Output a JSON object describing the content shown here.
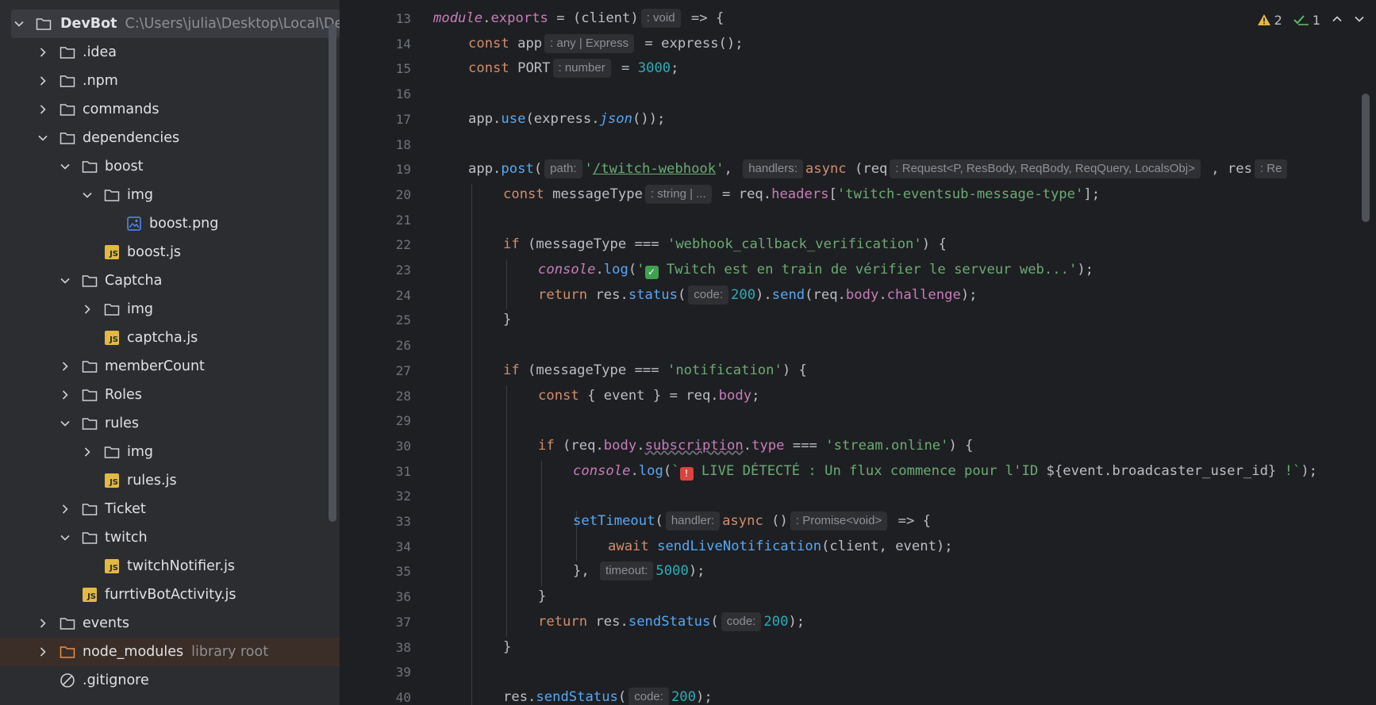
{
  "project_tree": {
    "root": {
      "name": "DevBot",
      "path": "C:\\Users\\julia\\Desktop\\Local\\Dev"
    },
    "items": [
      {
        "label": "idea",
        "name": ".idea",
        "type": "folder",
        "depth": 1,
        "expanded": false
      },
      {
        "label": "npm",
        "name": ".npm",
        "type": "folder",
        "depth": 1,
        "expanded": false
      },
      {
        "label": "commands",
        "name": "commands",
        "type": "folder",
        "depth": 1,
        "expanded": false
      },
      {
        "label": "dependencies",
        "name": "dependencies",
        "type": "folder",
        "depth": 1,
        "expanded": true
      },
      {
        "label": "boost",
        "name": "boost",
        "type": "folder",
        "depth": 2,
        "expanded": true
      },
      {
        "label": "img",
        "name": "img",
        "type": "folder",
        "depth": 3,
        "expanded": true
      },
      {
        "label": "boost-png",
        "name": "boost.png",
        "type": "image",
        "depth": 4
      },
      {
        "label": "boost-js",
        "name": "boost.js",
        "type": "js",
        "depth": 3
      },
      {
        "label": "captcha",
        "name": "Captcha",
        "type": "folder",
        "depth": 2,
        "expanded": true
      },
      {
        "label": "img",
        "name": "img",
        "type": "folder",
        "depth": 3,
        "expanded": false
      },
      {
        "label": "captcha-js",
        "name": "captcha.js",
        "type": "js",
        "depth": 3
      },
      {
        "label": "membercount",
        "name": "memberCount",
        "type": "folder",
        "depth": 2,
        "expanded": false
      },
      {
        "label": "roles",
        "name": "Roles",
        "type": "folder",
        "depth": 2,
        "expanded": false
      },
      {
        "label": "rules",
        "name": "rules",
        "type": "folder",
        "depth": 2,
        "expanded": true
      },
      {
        "label": "img",
        "name": "img",
        "type": "folder",
        "depth": 3,
        "expanded": false
      },
      {
        "label": "rules-js",
        "name": "rules.js",
        "type": "js",
        "depth": 3
      },
      {
        "label": "ticket",
        "name": "Ticket",
        "type": "folder",
        "depth": 2,
        "expanded": false
      },
      {
        "label": "twitch",
        "name": "twitch",
        "type": "folder",
        "depth": 2,
        "expanded": true
      },
      {
        "label": "twitchnotifier-js",
        "name": "twitchNotifier.js",
        "type": "js",
        "depth": 3
      },
      {
        "label": "furrtivbotactivity-js",
        "name": "furrtivBotActivity.js",
        "type": "js",
        "depth": 2
      },
      {
        "label": "events",
        "name": "events",
        "type": "folder",
        "depth": 1,
        "expanded": false
      },
      {
        "label": "node-modules",
        "name": "node_modules",
        "type": "folder-excluded",
        "depth": 1,
        "expanded": false,
        "note": "library root"
      },
      {
        "label": "gitignore",
        "name": ".gitignore",
        "type": "ignore",
        "depth": 1
      }
    ]
  },
  "inspections": {
    "warnings": "2",
    "ok": "1"
  },
  "editor": {
    "lines": [
      {
        "n": "13",
        "indent": 0,
        "tokens": [
          [
            "it prop",
            "module"
          ],
          [
            "",
            "."
          ],
          [
            "prop",
            "exports"
          ],
          [
            "",
            " = (client)"
          ],
          [
            "hint",
            ": void"
          ],
          [
            "",
            " => {"
          ]
        ]
      },
      {
        "n": "14",
        "indent": 1,
        "tokens": [
          [
            "kw",
            "const "
          ],
          [
            "",
            "app"
          ],
          [
            "hint",
            ": any | Express"
          ],
          [
            "",
            " = express();"
          ]
        ]
      },
      {
        "n": "15",
        "indent": 1,
        "tokens": [
          [
            "kw",
            "const "
          ],
          [
            "",
            "PORT"
          ],
          [
            "hint",
            ": number"
          ],
          [
            "",
            " = "
          ],
          [
            "num",
            "3000"
          ],
          [
            "",
            ";"
          ]
        ]
      },
      {
        "n": "16",
        "indent": 0,
        "tokens": []
      },
      {
        "n": "17",
        "indent": 1,
        "tokens": [
          [
            "",
            "app."
          ],
          [
            "fn",
            "use"
          ],
          [
            "",
            "(express."
          ],
          [
            "it fn",
            "json"
          ],
          [
            "",
            "());"
          ]
        ]
      },
      {
        "n": "18",
        "indent": 0,
        "tokens": []
      },
      {
        "n": "19",
        "indent": 1,
        "tokens": [
          [
            "",
            "app."
          ],
          [
            "fn",
            "post"
          ],
          [
            "",
            "("
          ],
          [
            "hint",
            "path:"
          ],
          [
            "str",
            "'"
          ],
          [
            "str und",
            "/twitch-webhook"
          ],
          [
            "str",
            "'"
          ],
          [
            "",
            ", "
          ],
          [
            "hint",
            "handlers:"
          ],
          [
            "kw",
            "async "
          ],
          [
            "",
            "(req"
          ],
          [
            "hint",
            ": Request<P, ResBody, ReqBody, ReqQuery, LocalsObj>"
          ],
          [
            "",
            " , res"
          ],
          [
            "hint",
            ": Re"
          ]
        ]
      },
      {
        "n": "20",
        "indent": 2,
        "tokens": [
          [
            "kw",
            "const "
          ],
          [
            "",
            "messageType"
          ],
          [
            "hint",
            ": string | ..."
          ],
          [
            "",
            " = req."
          ],
          [
            "prop",
            "headers"
          ],
          [
            "",
            "["
          ],
          [
            "str",
            "'twitch-eventsub-message-type'"
          ],
          [
            "",
            "];"
          ]
        ]
      },
      {
        "n": "21",
        "indent": 0,
        "tokens": []
      },
      {
        "n": "22",
        "indent": 2,
        "tokens": [
          [
            "kw",
            "if "
          ],
          [
            "",
            "(messageType === "
          ],
          [
            "str",
            "'webhook_callback_verification'"
          ],
          [
            "",
            ") {"
          ]
        ]
      },
      {
        "n": "23",
        "indent": 3,
        "tokens": [
          [
            "it prop",
            "console"
          ],
          [
            "",
            "."
          ],
          [
            "fn",
            "log"
          ],
          [
            "",
            "("
          ],
          [
            "str",
            "'"
          ],
          [
            "emoji-green",
            "✓"
          ],
          [
            "str",
            " Twitch est en train de vérifier le serveur web...'"
          ],
          [
            "",
            ");"
          ]
        ]
      },
      {
        "n": "24",
        "indent": 3,
        "tokens": [
          [
            "kw",
            "return "
          ],
          [
            "",
            "res."
          ],
          [
            "fn",
            "status"
          ],
          [
            "",
            "("
          ],
          [
            "hint",
            "code:"
          ],
          [
            "num",
            "200"
          ],
          [
            "",
            ")."
          ],
          [
            "fn",
            "send"
          ],
          [
            "",
            "(req."
          ],
          [
            "prop",
            "body"
          ],
          [
            "",
            "."
          ],
          [
            "prop",
            "challenge"
          ],
          [
            "",
            ");"
          ]
        ]
      },
      {
        "n": "25",
        "indent": 2,
        "tokens": [
          [
            "",
            "}"
          ]
        ]
      },
      {
        "n": "26",
        "indent": 0,
        "tokens": []
      },
      {
        "n": "27",
        "indent": 2,
        "tokens": [
          [
            "kw",
            "if "
          ],
          [
            "",
            "(messageType === "
          ],
          [
            "str",
            "'notification'"
          ],
          [
            "",
            ") {"
          ]
        ]
      },
      {
        "n": "28",
        "indent": 3,
        "tokens": [
          [
            "kw",
            "const "
          ],
          [
            "",
            "{ event } = req."
          ],
          [
            "prop",
            "body"
          ],
          [
            "",
            ";"
          ]
        ]
      },
      {
        "n": "29",
        "indent": 0,
        "tokens": []
      },
      {
        "n": "30",
        "indent": 3,
        "tokens": [
          [
            "kw",
            "if "
          ],
          [
            "",
            "(req."
          ],
          [
            "prop",
            "body"
          ],
          [
            "",
            "."
          ],
          [
            "prop wavy",
            "subscription"
          ],
          [
            "",
            "."
          ],
          [
            "prop",
            "type"
          ],
          [
            "",
            " === "
          ],
          [
            "str",
            "'stream.online'"
          ],
          [
            "",
            ") {"
          ]
        ]
      },
      {
        "n": "31",
        "indent": 4,
        "tokens": [
          [
            "it prop",
            "console"
          ],
          [
            "",
            "."
          ],
          [
            "fn",
            "log"
          ],
          [
            "",
            "("
          ],
          [
            "str",
            "`"
          ],
          [
            "emoji-red",
            "!"
          ],
          [
            "str",
            " LIVE DÉTECTÉ : Un flux commence pour l'ID "
          ],
          [
            "",
            "${event.broadcaster_user_id}"
          ],
          [
            "str",
            " !`"
          ],
          [
            "",
            ");"
          ]
        ]
      },
      {
        "n": "32",
        "indent": 0,
        "tokens": []
      },
      {
        "n": "33",
        "indent": 4,
        "tokens": [
          [
            "fn",
            "setTimeout"
          ],
          [
            "",
            "("
          ],
          [
            "hint",
            "handler:"
          ],
          [
            "kw",
            "async "
          ],
          [
            "",
            "()"
          ],
          [
            "hint",
            ": Promise<void>"
          ],
          [
            "",
            " => {"
          ]
        ]
      },
      {
        "n": "34",
        "indent": 5,
        "tokens": [
          [
            "kw",
            "await "
          ],
          [
            "fn",
            "sendLiveNotification"
          ],
          [
            "",
            "(client, event);"
          ]
        ]
      },
      {
        "n": "35",
        "indent": 4,
        "tokens": [
          [
            "",
            "}, "
          ],
          [
            "hint",
            "timeout:"
          ],
          [
            "num",
            "5000"
          ],
          [
            "",
            ");"
          ]
        ]
      },
      {
        "n": "36",
        "indent": 3,
        "tokens": [
          [
            "",
            "}"
          ]
        ]
      },
      {
        "n": "37",
        "indent": 3,
        "tokens": [
          [
            "kw",
            "return "
          ],
          [
            "",
            "res."
          ],
          [
            "fn",
            "sendStatus"
          ],
          [
            "",
            "("
          ],
          [
            "hint",
            "code:"
          ],
          [
            "num",
            "200"
          ],
          [
            "",
            ");"
          ]
        ]
      },
      {
        "n": "38",
        "indent": 2,
        "tokens": [
          [
            "",
            "}"
          ]
        ]
      },
      {
        "n": "39",
        "indent": 0,
        "tokens": []
      },
      {
        "n": "40",
        "indent": 2,
        "tokens": [
          [
            "",
            "res."
          ],
          [
            "fn",
            "sendStatus"
          ],
          [
            "",
            "("
          ],
          [
            "hint",
            "code:"
          ],
          [
            "num",
            "200"
          ],
          [
            "",
            ");"
          ]
        ]
      }
    ]
  },
  "colors": {
    "keyword": "#cf8e6d",
    "function": "#56a8f5",
    "property": "#c77dbb",
    "string": "#6aab73",
    "number": "#2aacb8",
    "folder_excluded": "#e8924e",
    "warning": "#e2b943",
    "ok": "#5fb865"
  }
}
